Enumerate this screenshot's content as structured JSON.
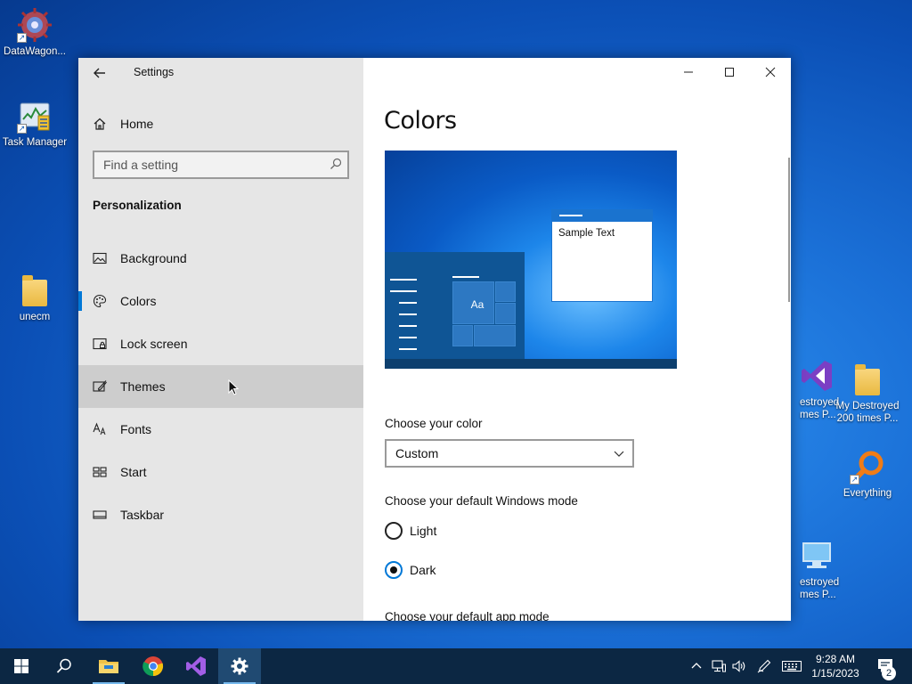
{
  "desktop": {
    "icons": [
      {
        "label": "DataWagon...",
        "icon": "datawagon-icon"
      },
      {
        "label": "Task Manager",
        "icon": "task-manager-icon"
      },
      {
        "label": "unecm",
        "icon": "folder-icon"
      },
      {
        "label": "Destroyed\nimes P...",
        "label_line1": "estroyed",
        "label_line2": "mes P...",
        "icon": "visual-studio-icon"
      },
      {
        "label_line1": "My Destroyed",
        "label_line2": "200 times P...",
        "icon": "folder-icon"
      },
      {
        "label": "Everything",
        "icon": "everything-search-icon"
      },
      {
        "label_line1": "estroyed",
        "label_line2": "mes P...",
        "icon": "computer-icon"
      }
    ]
  },
  "window": {
    "app_title": "Settings",
    "back_label": "Back",
    "nav": {
      "home_label": "Home",
      "search_placeholder": "Find a setting",
      "section_title": "Personalization",
      "items": [
        {
          "label": "Background",
          "icon": "picture-icon"
        },
        {
          "label": "Colors",
          "icon": "palette-icon",
          "selected": true
        },
        {
          "label": "Lock screen",
          "icon": "lock-screen-icon"
        },
        {
          "label": "Themes",
          "icon": "themes-brush-icon",
          "hover": true
        },
        {
          "label": "Fonts",
          "icon": "fonts-icon"
        },
        {
          "label": "Start",
          "icon": "start-tiles-icon"
        },
        {
          "label": "Taskbar",
          "icon": "taskbar-icon"
        }
      ]
    },
    "content": {
      "page_title": "Colors",
      "preview": {
        "sample_text": "Sample Text",
        "tile_text": "Aa"
      },
      "choose_color_label": "Choose your color",
      "choose_color_value": "Custom",
      "windows_mode_label": "Choose your default Windows mode",
      "windows_mode_options": [
        {
          "label": "Light",
          "checked": false
        },
        {
          "label": "Dark",
          "checked": true
        }
      ],
      "app_mode_label": "Choose your default app mode"
    }
  },
  "taskbar": {
    "apps": [
      "start-icon",
      "search-icon",
      "file-explorer-icon",
      "chrome-icon",
      "visual-studio-icon",
      "settings-gear-icon"
    ],
    "active_app": "settings-gear-icon",
    "clock_time": "9:28 AM",
    "clock_date": "1/15/2023",
    "notification_count": "2"
  },
  "colors": {
    "accent": "#0078d7",
    "nav_bg": "#e6e6e6",
    "taskbar_bg": "#0c2743"
  }
}
